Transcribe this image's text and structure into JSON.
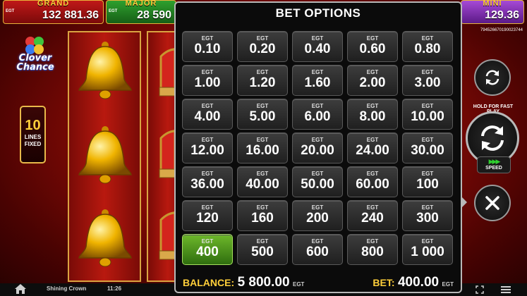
{
  "jackpots": {
    "grand": {
      "label": "GRAND",
      "value": "132 881.36",
      "currency": "EGT"
    },
    "major": {
      "label": "MAJOR",
      "value": "28 590",
      "currency": "EGT"
    },
    "mini": {
      "label": "MINI",
      "value": "129.36"
    }
  },
  "ticket_id": "794526670190023744",
  "logo_text": "Clover Chance",
  "lines": {
    "count": "10",
    "label": "LINES FIXED"
  },
  "bet_options": {
    "title": "BET OPTIONS",
    "currency": "EGT",
    "selected": "400",
    "options": [
      "0.10",
      "0.20",
      "0.40",
      "0.60",
      "0.80",
      "1.00",
      "1.20",
      "1.60",
      "2.00",
      "3.00",
      "4.00",
      "5.00",
      "6.00",
      "8.00",
      "10.00",
      "12.00",
      "16.00",
      "20.00",
      "24.00",
      "30.00",
      "36.00",
      "40.00",
      "50.00",
      "60.00",
      "100",
      "120",
      "160",
      "200",
      "240",
      "300",
      "400",
      "500",
      "600",
      "800",
      "1 000"
    ]
  },
  "balance": {
    "label": "BALANCE:",
    "value": "5 800.00",
    "currency": "EGT"
  },
  "bet": {
    "label": "BET:",
    "value": "400.00",
    "currency": "EGT"
  },
  "controls": {
    "hold_text": "HOLD FOR FAST PLAY",
    "speed_label": "SPEED"
  },
  "bottom": {
    "game_name": "Shining Crown",
    "clock": "11:26"
  },
  "colors": {
    "accent_gold": "#ffcf3a",
    "selected_green": "#6eb82b",
    "panel_bg": "#0b0b0b"
  }
}
